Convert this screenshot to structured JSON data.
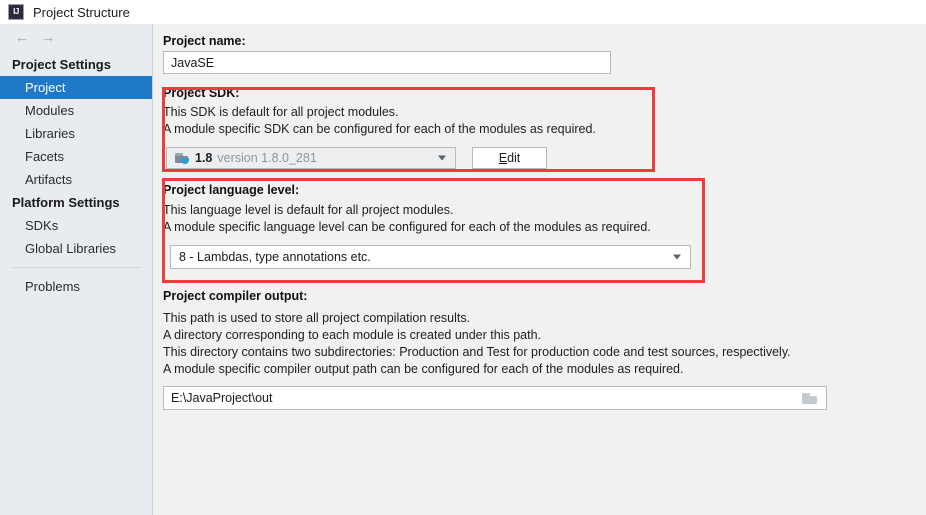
{
  "window": {
    "title": "Project Structure",
    "icon": "intellij-idea-icon",
    "icon_text": "IJ"
  },
  "nav": {
    "back_icon": "arrow-left-icon",
    "back_glyph": "←",
    "forward_icon": "arrow-right-icon",
    "forward_glyph": "→"
  },
  "sidebar": {
    "groups": [
      {
        "label": "Project Settings",
        "items": [
          {
            "label": "Project",
            "selected": true
          },
          {
            "label": "Modules",
            "selected": false
          },
          {
            "label": "Libraries",
            "selected": false
          },
          {
            "label": "Facets",
            "selected": false
          },
          {
            "label": "Artifacts",
            "selected": false
          }
        ]
      },
      {
        "label": "Platform Settings",
        "items": [
          {
            "label": "SDKs",
            "selected": false
          },
          {
            "label": "Global Libraries",
            "selected": false
          }
        ]
      }
    ],
    "problems": {
      "label": "Problems",
      "selected": false
    }
  },
  "main": {
    "project_name": {
      "label": "Project name:",
      "value": "JavaSE",
      "placeholder": ""
    },
    "project_sdk": {
      "title": "Project SDK:",
      "desc_line1": "This SDK is default for all project modules.",
      "desc_line2": "A module specific SDK can be configured for each of the modules as required.",
      "combo_icon": "java-sdk-icon",
      "combo_value_bold": "1.8",
      "combo_value_gray": "version 1.8.0_281",
      "edit_button_mnemonic": "E",
      "edit_button_rest": "dit",
      "edit_button_label": "Edit",
      "dropdown_icon": "chevron-down-icon"
    },
    "project_language_level": {
      "title": "Project language level:",
      "desc_line1": "This language level is default for all project modules.",
      "desc_line2": "A module specific language level can be configured for each of the modules as required.",
      "combo_value": "8 - Lambdas, type annotations etc.",
      "dropdown_icon": "chevron-down-icon"
    },
    "project_compiler_output": {
      "title": "Project compiler output:",
      "desc_line1": "This path is used to store all project compilation results.",
      "desc_line2": "A directory corresponding to each module is created under this path.",
      "desc_line3": "This directory contains two subdirectories: Production and Test for production code and test sources, respectively.",
      "desc_line4": "A module specific compiler output path can be configured for each of the modules as required.",
      "value": "E:\\JavaProject\\out",
      "placeholder": "",
      "browse_icon": "folder-browse-icon"
    }
  },
  "annotations": {
    "highlight_color": "#ee3b3b",
    "boxes": [
      {
        "name": "project-sdk-highlight"
      },
      {
        "name": "project-language-level-highlight"
      }
    ]
  },
  "colors": {
    "selection": "#2079c7",
    "sidebar_bg": "#e8ecf0",
    "panel_bg": "#f1f1f1",
    "accent_red": "#ee3b3b"
  }
}
